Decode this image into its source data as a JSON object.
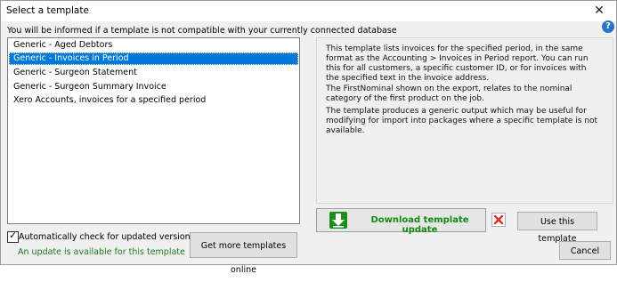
{
  "window": {
    "title": "Select a template",
    "close_glyph": "✕"
  },
  "info_text": "You will be informed if a template is not compatible with your currently connected database",
  "help_icon": {
    "glyph": "?",
    "name": "help-icon"
  },
  "templates": [
    {
      "label": "Generic - Aged Debtors",
      "selected": false
    },
    {
      "label": "Generic - Invoices in Period",
      "selected": true
    },
    {
      "label": "Generic - Surgeon Statement",
      "selected": false
    },
    {
      "label": "Generic - Surgeon Summary Invoice",
      "selected": false
    },
    {
      "label": "Xero Accounts, invoices for a specified period",
      "selected": false
    }
  ],
  "description": [
    "This template lists invoices for the specified period, in the same format as the Accounting > Invoices in Period report. You can run this for all customers, a specific customer ID, or for invoices with the specified text in the invoice address.",
    "The FirstNominal shown on the export, relates to the nominal category of the first product on the job.",
    "The template produces a generic output which may be useful for modifying for import into packages where a specific template is not available."
  ],
  "auto_check": {
    "label": "Automatically check for updated versions online",
    "checked": true
  },
  "update_message": "An update is available for this template",
  "buttons": {
    "more_templates": "Get more templates online",
    "download_update": "Download template update",
    "use_template": "Use this template",
    "cancel": "Cancel"
  },
  "colors": {
    "accent": "#0078d7",
    "download_green": "#118811",
    "update_text": "#1e7d1e",
    "delete_red": "#d9302c"
  },
  "icons": {
    "download": "download-arrow-icon",
    "delete": "delete-x-icon"
  }
}
